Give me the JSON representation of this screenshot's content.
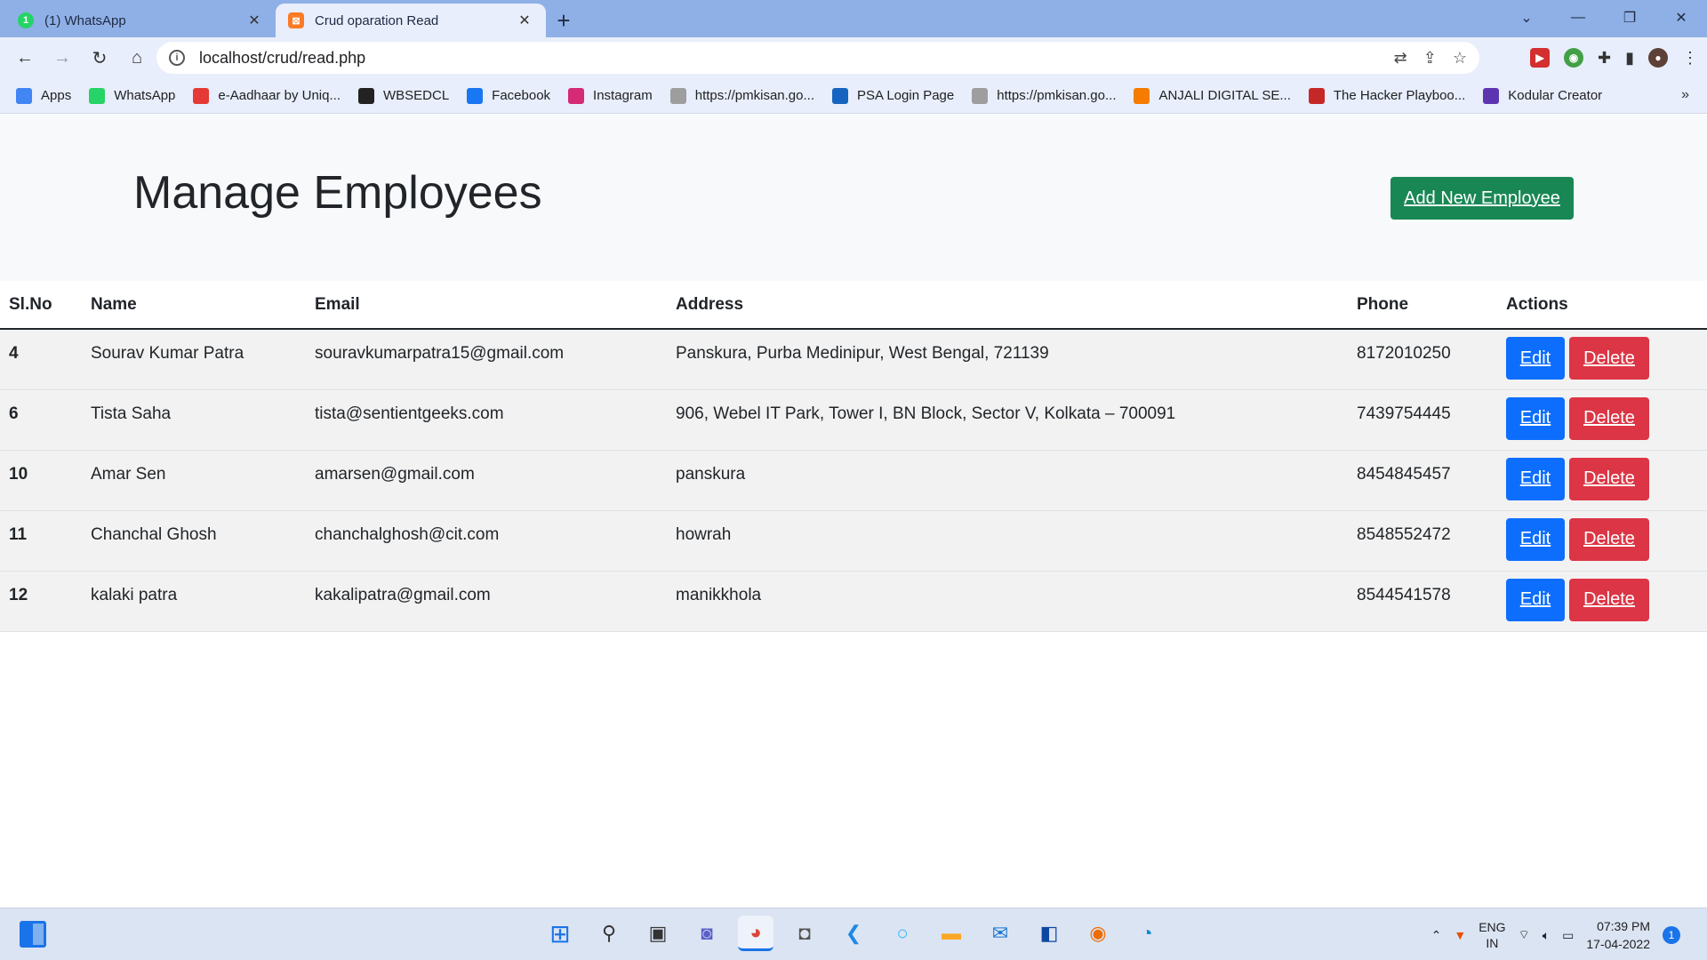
{
  "browser": {
    "tabs": [
      {
        "title": "(1) WhatsApp",
        "favicon": "whatsapp-icon",
        "active": false
      },
      {
        "title": "Crud oparation Read",
        "favicon": "xampp-icon",
        "active": true
      }
    ],
    "url": "localhost/crud/read.php",
    "bookmarks": [
      {
        "label": "Apps",
        "icon": "apps-grid-icon",
        "color": "#4285f4"
      },
      {
        "label": "WhatsApp",
        "icon": "whatsapp-icon",
        "color": "#25d366"
      },
      {
        "label": "e-Aadhaar by Uniq...",
        "icon": "aadhaar-icon",
        "color": "#e53935"
      },
      {
        "label": "WBSEDCL",
        "icon": "wbsedcl-icon",
        "color": "#222222"
      },
      {
        "label": "Facebook",
        "icon": "facebook-icon",
        "color": "#1877f2"
      },
      {
        "label": "Instagram",
        "icon": "instagram-icon",
        "color": "#d62976"
      },
      {
        "label": "https://pmkisan.go...",
        "icon": "page-icon",
        "color": "#9e9e9e"
      },
      {
        "label": "PSA Login Page",
        "icon": "psa-icon",
        "color": "#1565c0"
      },
      {
        "label": "https://pmkisan.go...",
        "icon": "page-icon",
        "color": "#9e9e9e"
      },
      {
        "label": "ANJALI DIGITAL SE...",
        "icon": "anjali-icon",
        "color": "#f57c00"
      },
      {
        "label": "The Hacker Playboo...",
        "icon": "pd-icon",
        "color": "#c62828"
      },
      {
        "label": "Kodular Creator",
        "icon": "kodular-icon",
        "color": "#5e35b1"
      }
    ]
  },
  "page": {
    "title": "Manage Employees",
    "add_button": "Add New Employee",
    "columns": [
      "Sl.No",
      "Name",
      "Email",
      "Address",
      "Phone",
      "Actions"
    ],
    "rows": [
      {
        "id": "4",
        "name": "Sourav Kumar Patra",
        "email": "souravkumarpatra15@gmail.com",
        "address": "Panskura, Purba Medinipur, West Bengal, 721139",
        "phone": "8172010250"
      },
      {
        "id": "6",
        "name": "Tista Saha",
        "email": "tista@sentientgeeks.com",
        "address": "906, Webel IT Park, Tower I, BN Block, Sector V, Kolkata – 700091",
        "phone": "7439754445"
      },
      {
        "id": "10",
        "name": "Amar Sen",
        "email": "amarsen@gmail.com",
        "address": "panskura",
        "phone": "8454845457"
      },
      {
        "id": "11",
        "name": "Chanchal Ghosh",
        "email": "chanchalghosh@cit.com",
        "address": "howrah",
        "phone": "8548552472"
      },
      {
        "id": "12",
        "name": "kalaki patra",
        "email": "kakalipatra@gmail.com",
        "address": "manikkhola",
        "phone": "8544541578"
      }
    ],
    "edit_label": "Edit",
    "delete_label": "Delete"
  },
  "taskbar": {
    "lang_top": "ENG",
    "lang_bottom": "IN",
    "time": "07:39 PM",
    "date": "17-04-2022",
    "notifications": "1"
  },
  "colors": {
    "add_button": "#198754",
    "edit_button": "#0d6efd",
    "delete_button": "#dc3545"
  }
}
